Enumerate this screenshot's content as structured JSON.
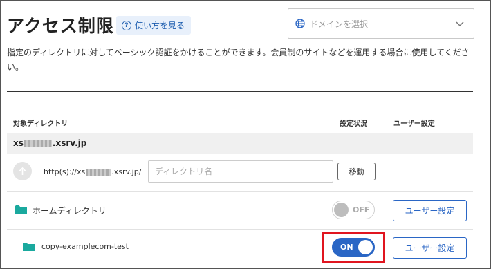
{
  "header": {
    "title": "アクセス制限",
    "howto_label": "使い方を見る"
  },
  "domain_select": {
    "placeholder": "ドメインを選択"
  },
  "description": "指定のディレクトリに対してベーシック認証をかけることができます。会員制のサイトなどを運用する場合に使用してください。",
  "table": {
    "headers": {
      "directory": "対象ディレクトリ",
      "status": "設定状況",
      "user": "ユーザー設定"
    },
    "domain": {
      "prefix": "xs",
      "suffix": ".xsrv.jp"
    },
    "path_row": {
      "prefix_start": "http(s)://xs",
      "prefix_end": ".xsrv.jp/",
      "input_placeholder": "ディレクトリ名",
      "move_label": "移動"
    },
    "rows": [
      {
        "name": "ホームディレクトリ",
        "toggle_label": "OFF",
        "user_button": "ユーザー設定"
      },
      {
        "name": "copy-examplecom-test",
        "toggle_label": "ON",
        "user_button": "ユーザー設定"
      }
    ]
  },
  "colors": {
    "accent": "#2a66c5",
    "highlight": "#e0151f",
    "folder": "#1aa99e"
  }
}
